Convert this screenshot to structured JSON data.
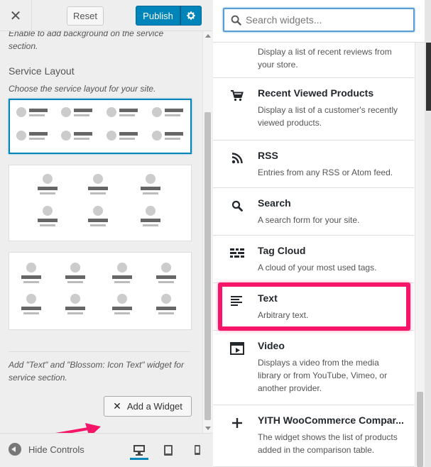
{
  "toolbar": {
    "close_glyph": "✕",
    "reset_label": "Reset",
    "publish_label": "Publish"
  },
  "section": {
    "clipped_description": "Enable to add background on the service section.",
    "layout_title": "Service Layout",
    "layout_description": "Choose the service layout for your site.",
    "selected_layout": 1,
    "widget_description": "Add \"Text\" and \"Blossom: Icon Text\" widget for service section.",
    "add_widget_label": "Add a Widget"
  },
  "footer": {
    "hide_controls_label": "Hide Controls"
  },
  "search": {
    "placeholder": "Search widgets..."
  },
  "widgets": [
    {
      "title": "",
      "description": "Display a list of recent reviews from your store.",
      "icon": "none"
    },
    {
      "title": "Recent Viewed Products",
      "description": "Display a list of a customer's recently viewed products.",
      "icon": "cart-icon"
    },
    {
      "title": "RSS",
      "description": "Entries from any RSS or Atom feed.",
      "icon": "rss-icon"
    },
    {
      "title": "Search",
      "description": "A search form for your site.",
      "icon": "search-icon"
    },
    {
      "title": "Tag Cloud",
      "description": "A cloud of your most used tags.",
      "icon": "tag-cloud-icon"
    },
    {
      "title": "Text",
      "description": "Arbitrary text.",
      "icon": "text-lines-icon"
    },
    {
      "title": "Video",
      "description": "Displays a video from the media library or from YouTube, Vimeo, or another provider.",
      "icon": "video-icon"
    },
    {
      "title": "YITH WooCommerce Compar...",
      "description": "The widget shows the list of products added in the comparison table.",
      "icon": "plus-icon"
    }
  ],
  "colors": {
    "accent": "#0085ba",
    "highlight": "#f5166a"
  }
}
